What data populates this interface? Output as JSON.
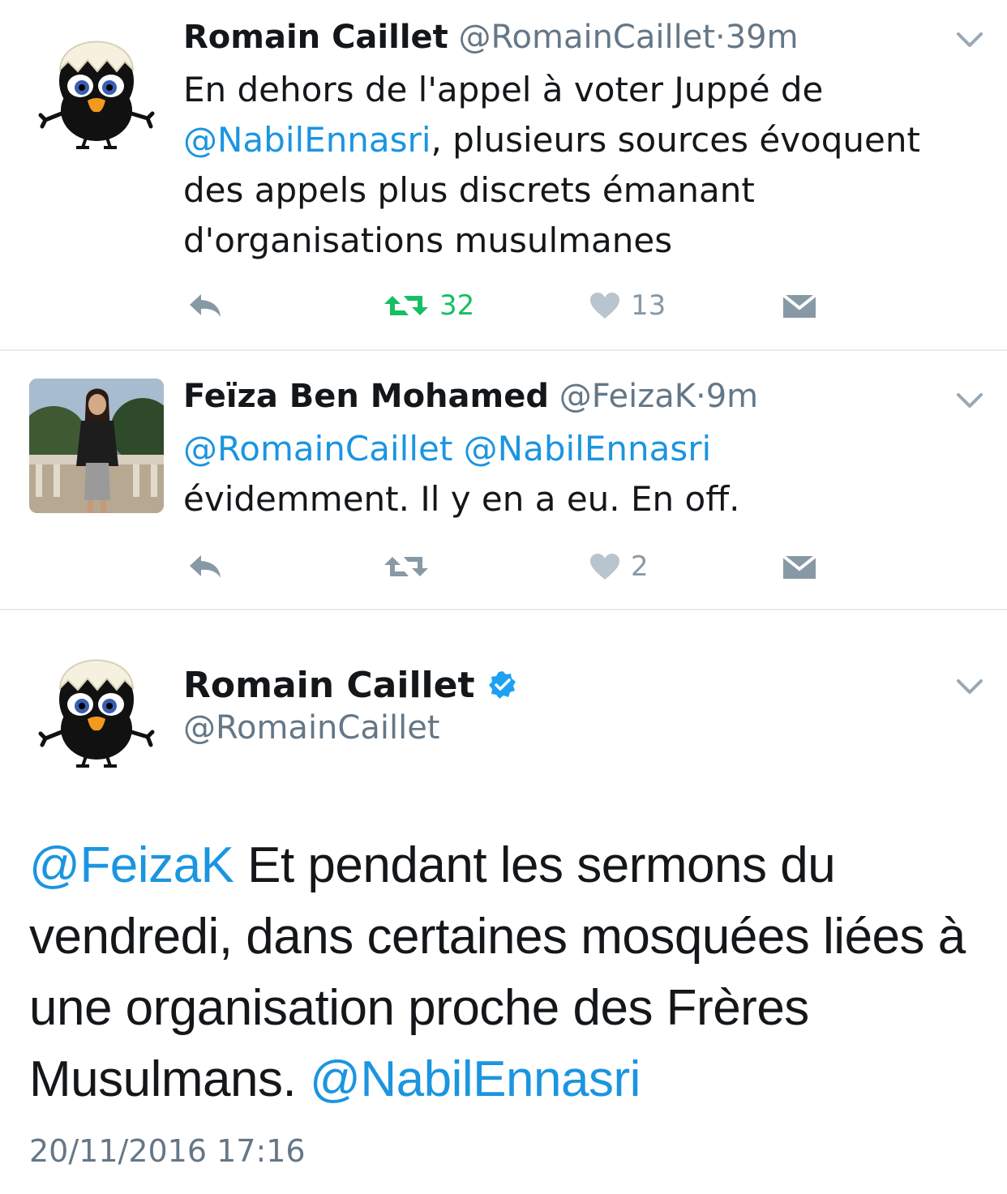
{
  "tweets": [
    {
      "name": "Romain Caillet",
      "handle": "@RomainCaillet",
      "sep": "·",
      "time": "39m",
      "text_1": "En dehors de l'appel à voter Juppé de",
      "mention_1": "@NabilEnnasri",
      "text_2": ", plusieurs sources évoquent des appels plus discrets émanant d'organisations musulmanes",
      "retweets": "32",
      "likes": "13",
      "retweeted": true
    },
    {
      "name": "Feïza Ben Mohamed",
      "handle": "@FeizaK",
      "sep": "·",
      "time": "9m",
      "mention_1": "@RomainCaillet",
      "mention_2": "@NabilEnnasri",
      "text_1": "évidemment. Il y en a eu. En off.",
      "retweets": "",
      "likes": "2",
      "retweeted": false
    }
  ],
  "detail": {
    "name": "Romain Caillet",
    "verified": true,
    "handle": "@RomainCaillet",
    "mention_1": "@FeizaK",
    "text_1": " Et pendant les sermons du vendredi, dans certaines mosquées liées à une organisation proche des Frères Musulmans. ",
    "mention_2": "@NabilEnnasri",
    "date": "20/11/2016 17:16"
  },
  "colors": {
    "link": "#1b95e0",
    "retweet_active": "#17bf63",
    "icon_gray": "#8899a6",
    "verified": "#1da1f2"
  },
  "icons": [
    "calimero-avatar",
    "person-photo-avatar",
    "chevron-down-icon",
    "reply-icon",
    "retweet-icon",
    "heart-icon",
    "dm-envelope-icon",
    "verified-badge-icon"
  ]
}
